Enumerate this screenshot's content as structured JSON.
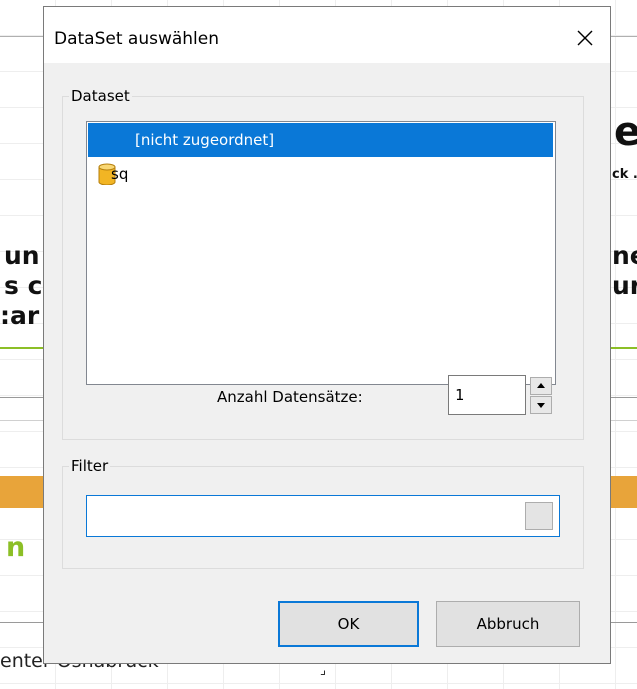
{
  "background": {
    "fragments": [
      "er",
      "ck .",
      "un",
      "s c",
      ":ar",
      "ne",
      "ur",
      "n",
      "enter Osnabrück",
      "⌟"
    ],
    "colors": {
      "accent_green": "#8cbf26",
      "accent_orange": "#e8a43a",
      "grid": "#eeeeee"
    }
  },
  "dialog": {
    "title": "DataSet auswählen",
    "close_icon": "close-icon",
    "dataset_group": {
      "legend": "Dataset",
      "items": [
        {
          "label": "[nicht zugeordnet]",
          "selected": true
        },
        {
          "label": "sq",
          "icon": "database-icon",
          "selected": false
        }
      ],
      "count_label": "Anzahl Datensätze:",
      "count_value": "1"
    },
    "filter_group": {
      "legend": "Filter",
      "value": ""
    },
    "buttons": {
      "ok": "OK",
      "cancel": "Abbruch"
    },
    "colors": {
      "selection": "#0a78d7",
      "dialog_bg": "#f0f0f0",
      "titlebar_bg": "#ffffff"
    }
  }
}
